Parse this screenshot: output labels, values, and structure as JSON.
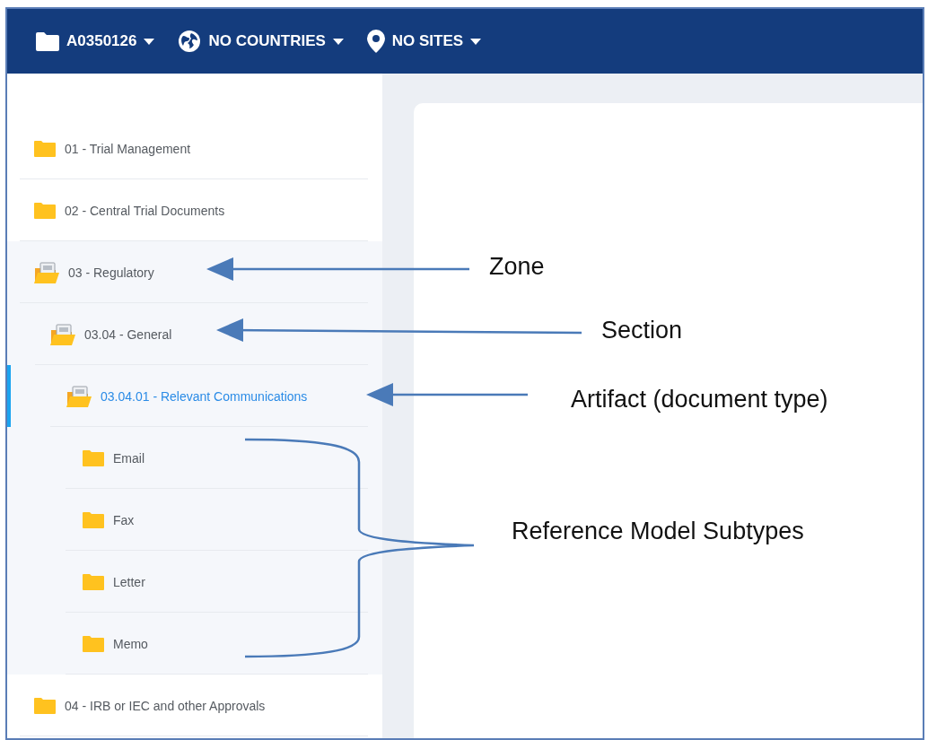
{
  "toolbar": [
    {
      "kind": "study",
      "label": "A0350126"
    },
    {
      "kind": "countries",
      "label": "NO COUNTRIES"
    },
    {
      "kind": "sites",
      "label": "NO SITES"
    }
  ],
  "tree": [
    {
      "label": "01 - Trial Management",
      "expanded": false,
      "selected": false
    },
    {
      "label": "02 - Central Trial Documents",
      "expanded": false,
      "selected": false
    },
    {
      "label": "03 - Regulatory",
      "expanded": true,
      "selected": false,
      "children": [
        {
          "label": "03.04 - General",
          "expanded": true,
          "selected": false,
          "children": [
            {
              "label": "03.04.01 - Relevant Communications",
              "expanded": true,
              "selected": true,
              "children": [
                {
                  "label": "Email",
                  "expanded": false,
                  "selected": false
                },
                {
                  "label": "Fax",
                  "expanded": false,
                  "selected": false
                },
                {
                  "label": "Letter",
                  "expanded": false,
                  "selected": false
                },
                {
                  "label": "Memo",
                  "expanded": false,
                  "selected": false
                }
              ]
            }
          ]
        }
      ]
    },
    {
      "label": "04 - IRB or IEC and other Approvals",
      "expanded": false,
      "selected": false
    }
  ],
  "annotations": [
    {
      "kind": "arrow",
      "label": "Zone"
    },
    {
      "kind": "arrow",
      "label": "Section"
    },
    {
      "kind": "arrow",
      "label": "Artifact (document type)"
    },
    {
      "kind": "brace",
      "label": "Reference Model Subtypes"
    }
  ]
}
